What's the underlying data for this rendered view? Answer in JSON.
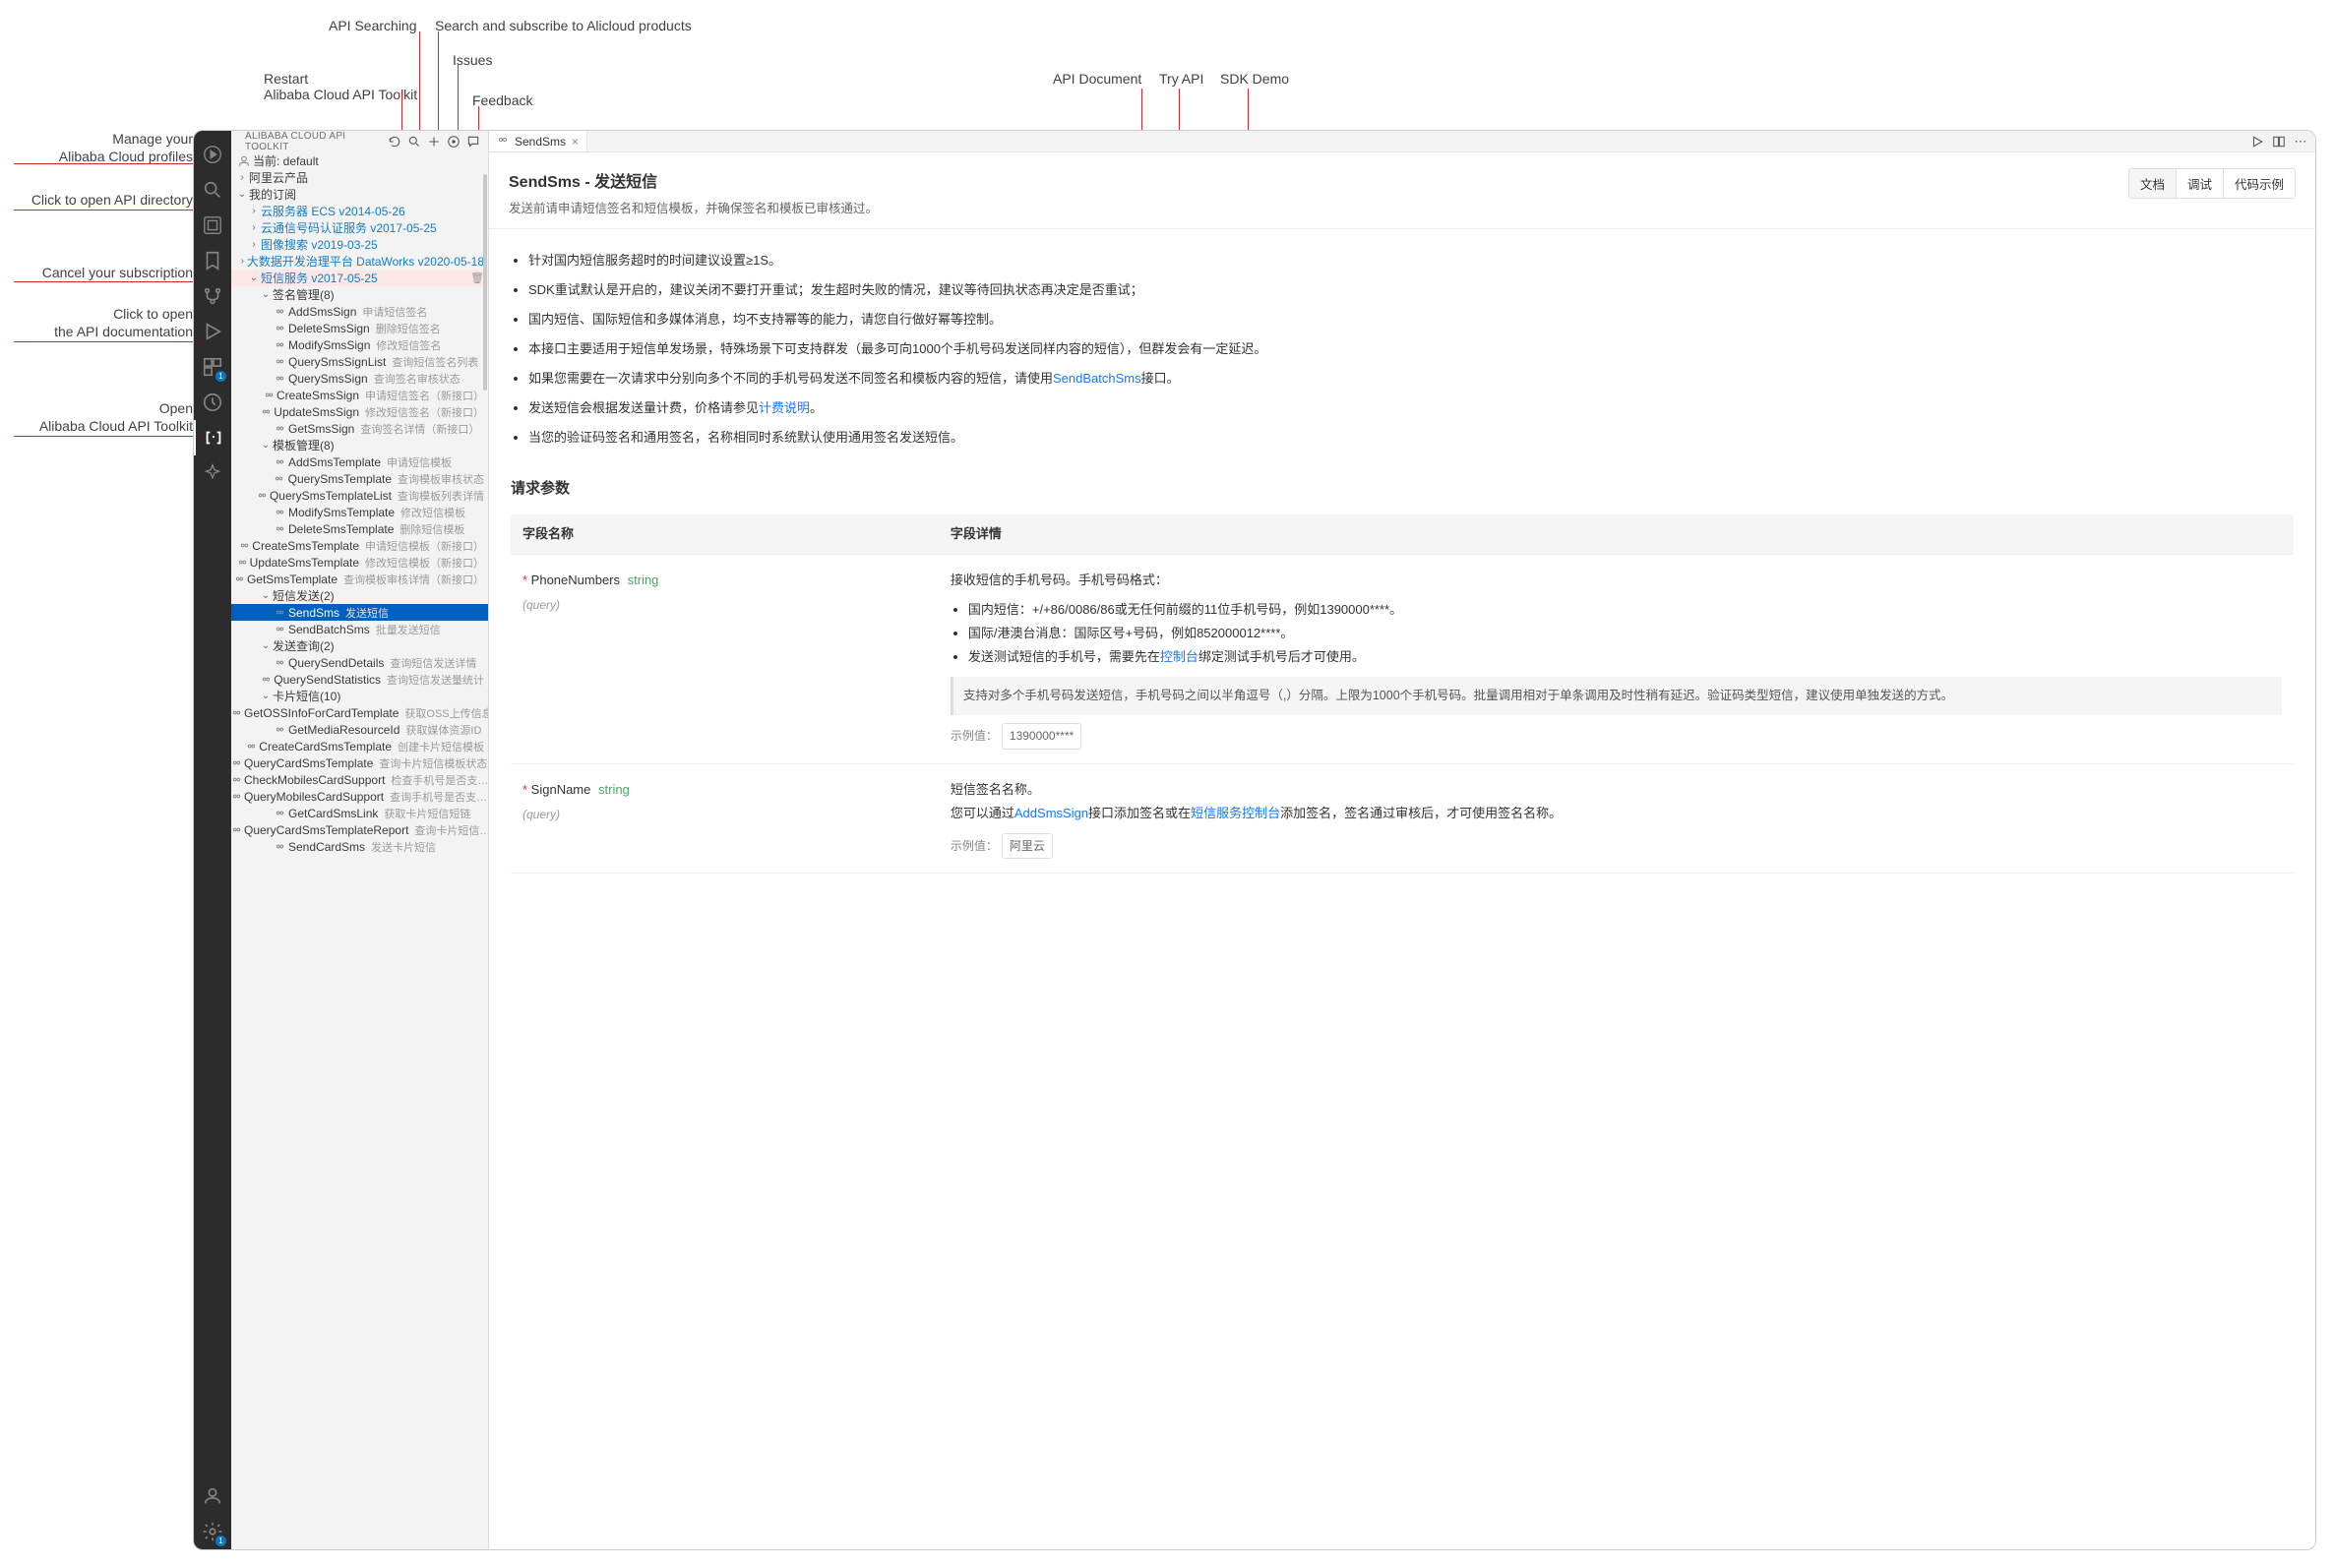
{
  "top_labels": {
    "restart": "Restart\nAlibaba Cloud API Toolkit",
    "api_searching": "API Searching",
    "subscribe": "Search and subscribe to Alicloud products",
    "issues": "Issues",
    "feedback": "Feedback",
    "api_document": "API Document",
    "try_api": "Try API",
    "sdk_demo": "SDK Demo"
  },
  "left_labels": {
    "profiles": "Manage your\nAlibaba Cloud profiles",
    "directory": "Click to open API directory",
    "cancel_sub": "Cancel your subscription",
    "open_doc": "Click to open\nthe API documentation",
    "open_toolkit": "Open\nAlibaba Cloud API Toolkit"
  },
  "sidebar": {
    "title": "ALIBABA CLOUD API TOOLKIT",
    "profile_label": "当前: default",
    "nodes": {
      "products": "阿里云产品",
      "subscriptions": "我的订阅",
      "ecs": "云服务器 ECS v2014-05-26",
      "dypns": "云通信号码认证服务 v2017-05-25",
      "imgsearch": "图像搜索 v2019-03-25",
      "dataworks": "大数据开发治理平台 DataWorks v2020-05-18",
      "dysms": "短信服务 v2017-05-25",
      "sign_mgmt": "签名管理(8)",
      "tpl_mgmt": "模板管理(8)",
      "sms_send": "短信发送(2)",
      "send_query": "发送查询(2)",
      "card_sms": "卡片短信(10)"
    },
    "apis": {
      "AddSmsSign": {
        "n": "AddSmsSign",
        "h": "申请短信签名"
      },
      "DeleteSmsSign": {
        "n": "DeleteSmsSign",
        "h": "删除短信签名"
      },
      "ModifySmsSign": {
        "n": "ModifySmsSign",
        "h": "修改短信签名"
      },
      "QuerySmsSignList": {
        "n": "QuerySmsSignList",
        "h": "查询短信签名列表"
      },
      "QuerySmsSign": {
        "n": "QuerySmsSign",
        "h": "查询签名审核状态"
      },
      "CreateSmsSign": {
        "n": "CreateSmsSign",
        "h": "申请短信签名（新接口）"
      },
      "UpdateSmsSign": {
        "n": "UpdateSmsSign",
        "h": "修改短信签名（新接口）"
      },
      "GetSmsSign": {
        "n": "GetSmsSign",
        "h": "查询签名详情（新接口）"
      },
      "AddSmsTemplate": {
        "n": "AddSmsTemplate",
        "h": "申请短信模板"
      },
      "QuerySmsTemplate": {
        "n": "QuerySmsTemplate",
        "h": "查询模板审核状态"
      },
      "QuerySmsTemplateList": {
        "n": "QuerySmsTemplateList",
        "h": "查询模板列表详情"
      },
      "ModifySmsTemplate": {
        "n": "ModifySmsTemplate",
        "h": "修改短信模板"
      },
      "DeleteSmsTemplate": {
        "n": "DeleteSmsTemplate",
        "h": "删除短信模板"
      },
      "CreateSmsTemplate": {
        "n": "CreateSmsTemplate",
        "h": "申请短信模板（新接口）"
      },
      "UpdateSmsTemplate": {
        "n": "UpdateSmsTemplate",
        "h": "修改短信模板（新接口）"
      },
      "GetSmsTemplate": {
        "n": "GetSmsTemplate",
        "h": "查询模板审核详情（新接口）"
      },
      "SendSms": {
        "n": "SendSms",
        "h": "发送短信"
      },
      "SendBatchSms": {
        "n": "SendBatchSms",
        "h": "批量发送短信"
      },
      "QuerySendDetails": {
        "n": "QuerySendDetails",
        "h": "查询短信发送详情"
      },
      "QuerySendStatistics": {
        "n": "QuerySendStatistics",
        "h": "查询短信发送量统计"
      },
      "GetOSSInfoForCardTemplate": {
        "n": "GetOSSInfoForCardTemplate",
        "h": "获取OSS上传信息"
      },
      "GetMediaResourceId": {
        "n": "GetMediaResourceId",
        "h": "获取媒体资源ID"
      },
      "CreateCardSmsTemplate": {
        "n": "CreateCardSmsTemplate",
        "h": "创建卡片短信模板"
      },
      "QueryCardSmsTemplate": {
        "n": "QueryCardSmsTemplate",
        "h": "查询卡片短信模板状态"
      },
      "CheckMobilesCardSupport": {
        "n": "CheckMobilesCardSupport",
        "h": "检查手机号是否支…"
      },
      "QueryMobilesCardSupport": {
        "n": "QueryMobilesCardSupport",
        "h": "查询手机号是否支…"
      },
      "GetCardSmsLink": {
        "n": "GetCardSmsLink",
        "h": "获取卡片短信短链"
      },
      "QueryCardSmsTemplateReport": {
        "n": "QueryCardSmsTemplateReport",
        "h": "查询卡片短信…"
      },
      "SendCardSms": {
        "n": "SendCardSms",
        "h": "发送卡片短信"
      }
    }
  },
  "tab": {
    "name": "SendSms"
  },
  "content": {
    "title": "SendSms - 发送短信",
    "subtitle": "发送前请申请短信签名和短信模板，并确保签名和模板已审核通过。",
    "tabs": {
      "doc": "文档",
      "debug": "调试",
      "demo": "代码示例"
    },
    "bullets": [
      "针对国内短信服务超时的时间建议设置≥1S。",
      "SDK重试默认是开启的，建议关闭不要打开重试；发生超时失败的情况，建议等待回执状态再决定是否重试；",
      "国内短信、国际短信和多媒体消息，均不支持幂等的能力，请您自行做好幂等控制。",
      "本接口主要适用于短信单发场景，特殊场景下可支持群发（最多可向1000个手机号码发送同样内容的短信），但群发会有一定延迟。",
      "发送短信会根据发送量计费，价格请参见"
    ],
    "bullet5_prefix": "如果您需要在一次请求中分别向多个不同的手机号码发送不同签名和模板内容的短信，请使用",
    "bullet5_link": "SendBatchSms",
    "bullet5_suffix": "接口。",
    "pricing_link": "计费说明",
    "bullet7": "当您的验证码签名和通用签名，名称相同时系统默认使用通用签名发送短信。",
    "section_params": "请求参数",
    "th_name": "字段名称",
    "th_detail": "字段详情",
    "phone": {
      "name": "PhoneNumbers",
      "type": "string",
      "where": "(query)",
      "intro": "接收短信的手机号码。手机号码格式：",
      "li1": "国内短信：+/+86/0086/86或无任何前缀的11位手机号码，例如1390000****。",
      "li2": "国际/港澳台消息：国际区号+号码，例如852000012****。",
      "li3_prefix": "发送测试短信的手机号，需要先在",
      "li3_link": "控制台",
      "li3_suffix": "绑定测试手机号后才可使用。",
      "note": "支持对多个手机号码发送短信，手机号码之间以半角逗号（,）分隔。上限为1000个手机号码。批量调用相对于单条调用及时性稍有延迟。验证码类型短信，建议使用单独发送的方式。",
      "example_label": "示例值：",
      "example_val": "1390000****"
    },
    "sign": {
      "name": "SignName",
      "type": "string",
      "where": "(query)",
      "intro": "短信签名名称。",
      "line2_prefix": "您可以通过",
      "line2_link1": "AddSmsSign",
      "line2_mid": "接口添加签名或在",
      "line2_link2": "短信服务控制台",
      "line2_suffix": "添加签名，签名通过审核后，才可使用签名名称。",
      "example_label": "示例值：",
      "example_val": "阿里云"
    }
  }
}
